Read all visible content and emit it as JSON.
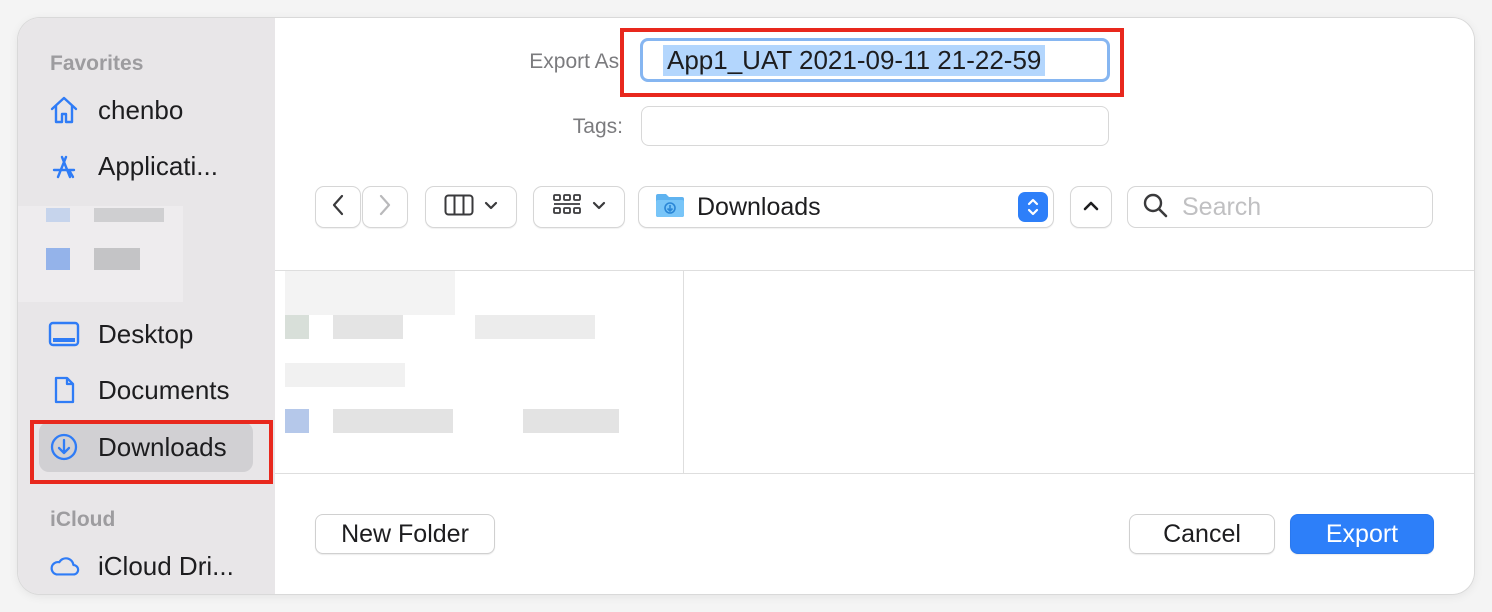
{
  "sidebar": {
    "favorites_title": "Favorites",
    "icloud_title": "iCloud",
    "items": [
      {
        "label": "chenbo",
        "icon": "home-icon"
      },
      {
        "label": "Applicati...",
        "icon": "applications-icon"
      },
      {
        "label": "Desktop",
        "icon": "desktop-icon"
      },
      {
        "label": "Documents",
        "icon": "document-icon"
      },
      {
        "label": "Downloads",
        "icon": "download-circle-icon",
        "selected": true
      },
      {
        "label": "iCloud Dri...",
        "icon": "cloud-icon"
      }
    ]
  },
  "form": {
    "export_as_label": "Export As:",
    "file_name": "App1_UAT 2021-09-11 21-22-59",
    "tags_label": "Tags:",
    "tags_value": ""
  },
  "toolbar": {
    "location": "Downloads",
    "search_placeholder": "Search"
  },
  "buttons": {
    "new_folder": "New Folder",
    "cancel": "Cancel",
    "export": "Export"
  },
  "colors": {
    "accent": "#2d7ff9",
    "sidebar_icon": "#2f7cf6",
    "selection": "#b3d6fd",
    "annotation": "#e8281d"
  }
}
